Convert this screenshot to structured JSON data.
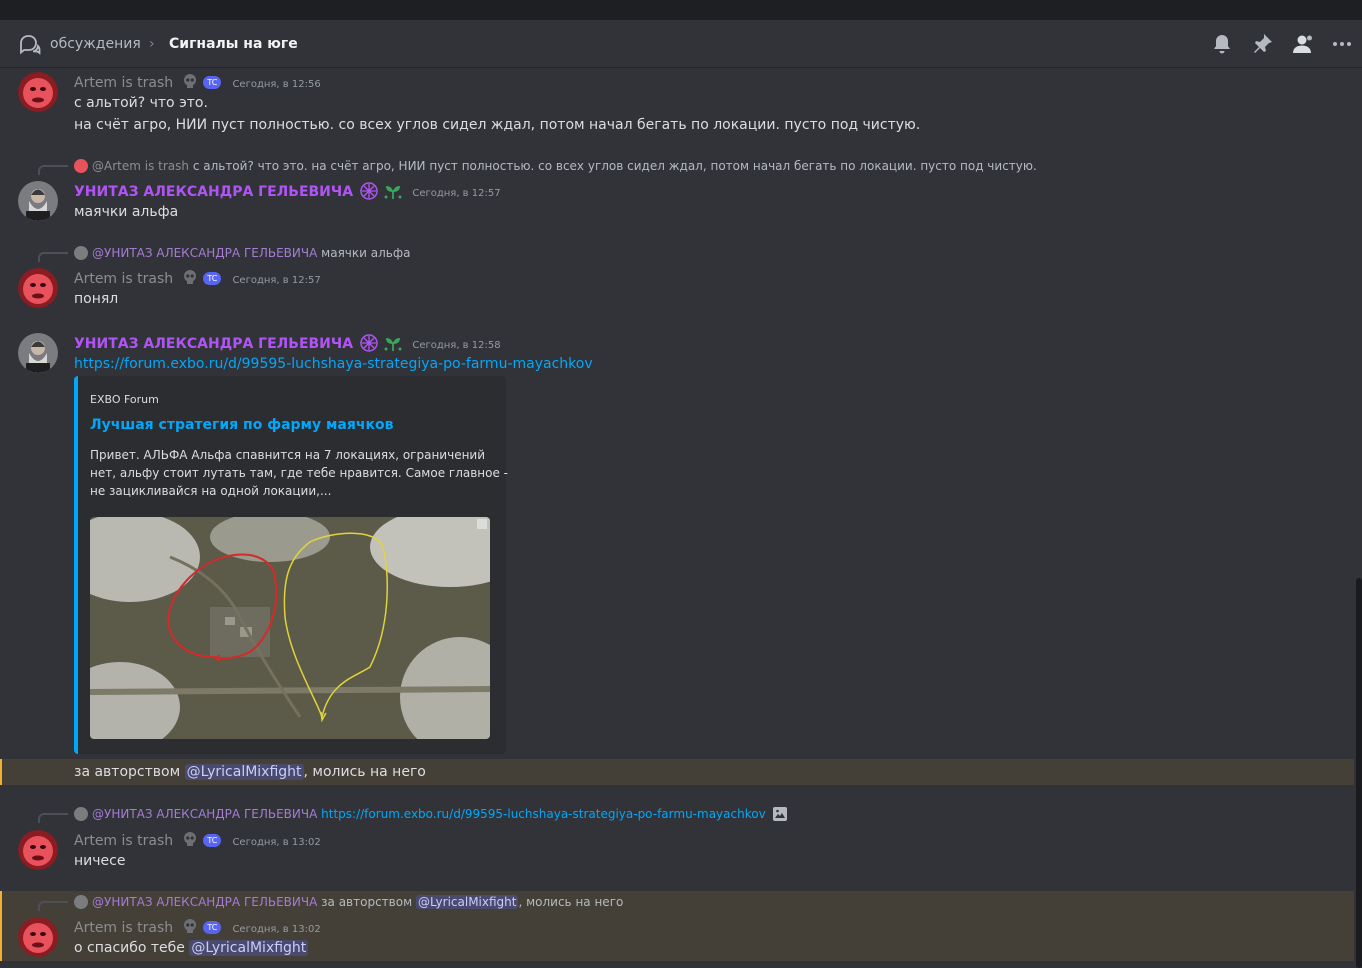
{
  "header": {
    "breadcrumb_parent": "обсуждения",
    "breadcrumb_sep": "›",
    "channel_title": "Сигналы на юге",
    "icons": [
      "threads-icon",
      "bell-icon",
      "pin-icon",
      "members-icon",
      "more-icon"
    ]
  },
  "messages": {
    "m1": {
      "author": "Artem is trash",
      "badge": "TC",
      "timestamp": "Сегодня, в 12:56",
      "line1": "с альтой? что это.",
      "line2": "на счёт агро, НИИ пуст полностью. со всех углов сидел ждал, потом начал бегать по локации. пусто под чистую."
    },
    "m2": {
      "reply_author": "@Artem is trash",
      "reply_text": "с альтой? что это. на счёт агро, НИИ пуст полностью. со всех углов сидел ждал, потом начал бегать по локации. пусто под чистую.",
      "author": "УНИТАЗ АЛЕКСАНДРА ГЕЛЬЕВИЧА",
      "timestamp": "Сегодня, в 12:57",
      "text": "маячки альфа"
    },
    "m3": {
      "reply_author": "@УНИТАЗ АЛЕКСАНДРА ГЕЛЬЕВИЧА",
      "reply_text": "маячки альфа",
      "author": "Artem is trash",
      "badge": "TC",
      "timestamp": "Сегодня, в 12:57",
      "text": "понял"
    },
    "m4": {
      "author": "УНИТАЗ АЛЕКСАНДРА ГЕЛЬЕВИЧА",
      "timestamp": "Сегодня, в 12:58",
      "link": "https://forum.exbo.ru/d/99595-luchshaya-strategiya-po-farmu-mayachkov",
      "embed": {
        "provider": "EXBO Forum",
        "title": "Лучшая стратегия по фарму маячков",
        "desc1": "Привет. АЛЬФА Альфа спавнится на 7 локациях, ограничений",
        "desc2": "нет, альфу стоит лутать там, где тебе нравится. Самое главное -",
        "desc3": "не зацикливайся на одной локации,..."
      },
      "follow_prefix": "за авторством ",
      "follow_mention": "@LyricalMixfight",
      "follow_suffix": ", молись на него"
    },
    "m5": {
      "reply_author": "@УНИТАЗ АЛЕКСАНДРА ГЕЛЬЕВИЧА",
      "reply_link": "https://forum.exbo.ru/d/99595-luchshaya-strategiya-po-farmu-mayachkov",
      "author": "Artem is trash",
      "badge": "TC",
      "timestamp": "Сегодня, в 13:02",
      "text": "ничесе"
    },
    "m6": {
      "reply_author": "@УНИТАЗ АЛЕКСАНДРА ГЕЛЬЕВИЧА",
      "reply_prefix": "за авторством ",
      "reply_mention": "@LyricalMixfight",
      "reply_suffix": ", молись на него",
      "author": "Artem is trash",
      "badge": "TC",
      "timestamp": "Сегодня, в 13:02",
      "text_prefix": "о спасибо тебе ",
      "text_mention": "@LyricalMixfight"
    }
  },
  "colors": {
    "background": "#313338",
    "purple_name": "#b154f5",
    "link": "#00a8fc",
    "highlight_bar": "#f0b132",
    "mention_bg": "#5865f2"
  }
}
